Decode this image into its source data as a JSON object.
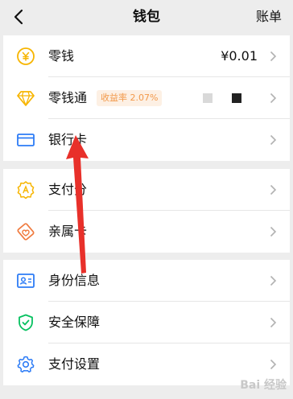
{
  "header": {
    "title": "钱包",
    "bill_label": "账单"
  },
  "groups": [
    {
      "items": [
        {
          "label": "零钱",
          "icon": "coin-yen-icon",
          "value": "¥0.01"
        },
        {
          "label": "零钱通",
          "icon": "diamond-icon",
          "badge": "收益率 2.07%"
        },
        {
          "label": "银行卡",
          "icon": "bank-card-icon"
        }
      ]
    },
    {
      "items": [
        {
          "label": "支付分",
          "icon": "payment-score-icon"
        },
        {
          "label": "亲属卡",
          "icon": "family-card-icon"
        }
      ]
    },
    {
      "items": [
        {
          "label": "身份信息",
          "icon": "id-card-icon"
        },
        {
          "label": "安全保障",
          "icon": "shield-icon"
        },
        {
          "label": "支付设置",
          "icon": "gear-icon"
        }
      ]
    }
  ],
  "watermark": "Bai 经验",
  "colors": {
    "accent_yellow": "#f7b500",
    "accent_blue": "#2d7cf6",
    "accent_green": "#07c160",
    "accent_orange": "#f07b3f",
    "arrow_red": "#e8302a"
  }
}
